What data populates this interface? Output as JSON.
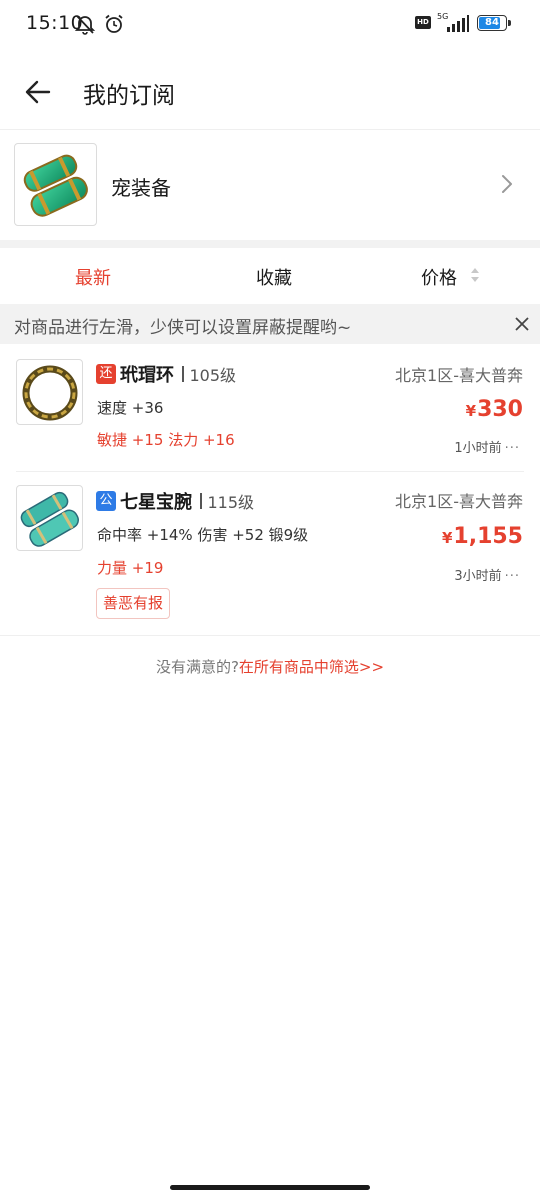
{
  "status_bar": {
    "time": "15:10",
    "network": "5G",
    "hd_label": "HD",
    "battery": "84",
    "battery_level": 0.84
  },
  "header": {
    "title": "我的订阅",
    "back_icon": "arrow-left-icon"
  },
  "subscription": {
    "name": "宠装备",
    "chevron_icon": "chevron-right-icon"
  },
  "tabs": [
    {
      "label": "最新",
      "active": true
    },
    {
      "label": "收藏",
      "active": false
    },
    {
      "label": "价格",
      "active": false
    }
  ],
  "tip": {
    "text": "对商品进行左滑，少侠可以设置屏蔽提醒哟~",
    "close_icon": "close-icon"
  },
  "items": [
    {
      "tag": "还",
      "tag_color": "#e5412f",
      "name": "玳瑁环",
      "level": "105级",
      "server": "北京1区-喜大普奔",
      "attr1": "速度 +36",
      "attr2": "敏捷 +15 法力 +16",
      "currency": "¥",
      "price": "330",
      "time": "1小时前",
      "more": "···"
    },
    {
      "tag": "公",
      "tag_color": "#2e7be6",
      "name": "七星宝腕",
      "level": "115级",
      "server": "北京1区-喜大普奔",
      "attr1": "命中率 +14% 伤害 +52 锻9级",
      "attr2": "力量 +19",
      "currency": "¥",
      "price": "1,155",
      "time": "3小时前",
      "more": "···",
      "badge": "善恶有报"
    }
  ],
  "footer": {
    "prefix": "没有满意的?",
    "link": "在所有商品中筛选>>"
  },
  "colors": {
    "accent": "#e5412f",
    "tag_blue": "#2e7be6",
    "band_gray": "#f2f2f2"
  }
}
